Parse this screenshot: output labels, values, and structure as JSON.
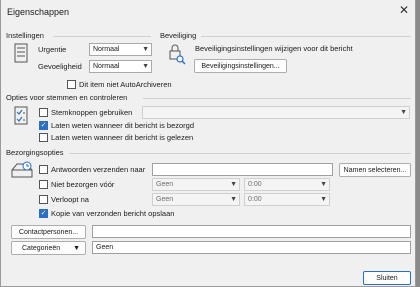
{
  "window": {
    "title": "Eigenschappen",
    "close_glyph": "✕"
  },
  "settings": {
    "heading": "Instellingen",
    "importance_label": "Urgentie",
    "importance_value": "Normaal",
    "sensitivity_label": "Gevoeligheid",
    "sensitivity_value": "Normaal",
    "no_autoarchive_label": "Dit item niet AutoArchiveren"
  },
  "security": {
    "heading": "Beveiliging",
    "text": "Beveiligingsinstellingen wijzigen voor dit bericht",
    "button_label": "Beveiligingsinstellingen..."
  },
  "voting": {
    "heading": "Opties voor stemmen en controleren",
    "voting_buttons_label": "Stemknoppen gebruiken",
    "delivered_label": "Laten weten wanneer dit bericht is bezorgd",
    "read_label": "Laten weten wanneer dit bericht is gelezen"
  },
  "delivery": {
    "heading": "Bezorgingsopties",
    "reply_to_label": "Antwoorden verzenden naar",
    "select_names_button": "Namen selecteren...",
    "do_not_deliver_label": "Niet bezorgen vóór",
    "do_not_deliver_date": "Geen",
    "do_not_deliver_time": "0:00",
    "expires_label": "Verloopt na",
    "expires_date": "Geen",
    "expires_time": "0:00",
    "save_copy_label": "Kopie van verzonden bericht opslaan"
  },
  "contacts": {
    "button_label": "Contactpersonen..."
  },
  "categories": {
    "button_label": "Categorieën",
    "value": "Geen"
  },
  "footer": {
    "close_button": "Sluiten"
  },
  "checks": {
    "no_autoarchive": false,
    "voting_buttons": false,
    "delivered": true,
    "read": false,
    "reply_to": false,
    "do_not_deliver": false,
    "expires": false,
    "save_copy": true
  }
}
